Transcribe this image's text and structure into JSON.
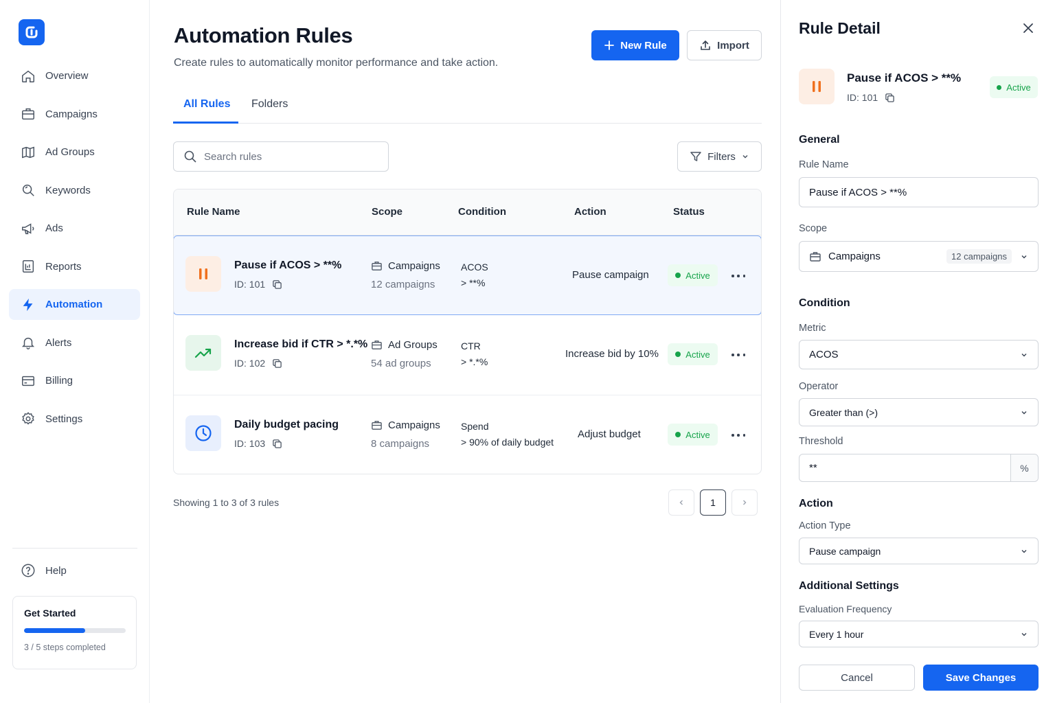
{
  "colors": {
    "brand": "#1565f0",
    "active_green": "#16a34a",
    "active_green_bg": "#ecfbf1",
    "orange": "#f0701e",
    "orange_bg": "#fdeee4",
    "green_icon": "#16a34a",
    "green_icon_bg": "#e7f6ec",
    "blue_icon": "#1565f0",
    "blue_icon_bg": "#e8effd"
  },
  "sidebar": {
    "logo_icon": "app-logo-icon",
    "items": [
      {
        "label": "Overview",
        "icon": "home-icon"
      },
      {
        "label": "Campaigns",
        "icon": "briefcase-icon"
      },
      {
        "label": "Ad Groups",
        "icon": "map-icon"
      },
      {
        "label": "Keywords",
        "icon": "search-icon"
      },
      {
        "label": "Ads",
        "icon": "megaphone-icon"
      },
      {
        "label": "Reports",
        "icon": "report-icon"
      },
      {
        "label": "Automation",
        "icon": "lightning-icon",
        "active": true
      },
      {
        "label": "Alerts",
        "icon": "bell-icon"
      },
      {
        "label": "Billing",
        "icon": "credit-card-icon"
      },
      {
        "label": "Settings",
        "icon": "gear-icon"
      }
    ],
    "help_label": "Help",
    "get_started": {
      "title": "Get Started",
      "progress": 0.6,
      "steps_text": "3 / 5 steps completed"
    }
  },
  "main": {
    "title": "Automation Rules",
    "subtitle": "Create rules to automatically monitor performance and take action.",
    "new_rule_label": "New Rule",
    "import_label": "Import",
    "tabs": [
      {
        "label": "All Rules",
        "active": true
      },
      {
        "label": "Folders"
      }
    ],
    "search_placeholder": "Search rules",
    "filters_label": "Filters",
    "table": {
      "headers": {
        "rule_name": "Rule Name",
        "scope": "Scope",
        "condition": "Condition",
        "action": "Action",
        "status": "Status"
      },
      "rows": [
        {
          "name": "Pause if ACOS > **%",
          "id": "ID: 101",
          "icon": "pause-icon",
          "scope_type": "Campaigns",
          "scope_count": "12 campaigns",
          "condition_metric": "ACOS",
          "condition_rule": "> **%",
          "action": "Pause campaign",
          "status": "Active"
        },
        {
          "name": "Increase bid if CTR > *.*%",
          "id": "ID: 102",
          "icon": "trending-up-icon",
          "scope_type": "Ad Groups",
          "scope_count": "54 ad groups",
          "condition_metric": "CTR",
          "condition_rule": "> *.*%",
          "action": "Increase bid by 10%",
          "status": "Active"
        },
        {
          "name": "Daily budget pacing",
          "id": "ID: 103",
          "icon": "clock-icon",
          "scope_type": "Campaigns",
          "scope_count": "8 campaigns",
          "condition_metric": "Spend",
          "condition_rule": "> 90% of daily budget",
          "action": "Adjust budget",
          "status": "Active"
        }
      ]
    },
    "showing_text": "Showing 1 to 3 of 3 rules",
    "pagination": {
      "current": "1"
    }
  },
  "panel": {
    "title": "Rule Detail",
    "rule_name": "Pause if ACOS > **%",
    "rule_id": "ID: 101",
    "status": "Active",
    "general_heading": "General",
    "rule_name_label": "Rule Name",
    "rule_name_value": "Pause if ACOS > **%",
    "scope_label": "Scope",
    "scope_value": "Campaigns",
    "scope_chip": "12 campaigns",
    "condition_heading": "Condition",
    "metric_label": "Metric",
    "metric_value": "ACOS",
    "operator_label": "Operator",
    "operator_value": "Greater than (>)",
    "threshold_label": "Threshold",
    "threshold_value": "**",
    "threshold_suffix": "%",
    "action_heading": "Action",
    "action_type_label": "Action Type",
    "action_type_value": "Pause campaign",
    "additional_heading": "Additional Settings",
    "frequency_label": "Evaluation Frequency",
    "frequency_value": "Every 1 hour",
    "cancel_label": "Cancel",
    "save_label": "Save Changes"
  }
}
